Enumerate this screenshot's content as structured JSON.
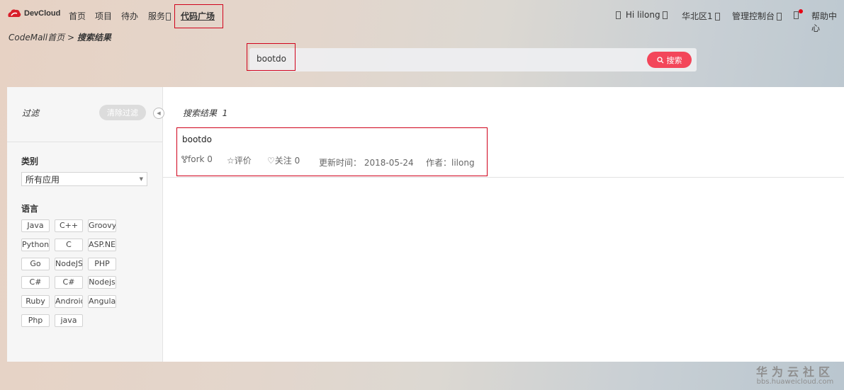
{
  "nav": {
    "brand": "DevCloud",
    "items": [
      "首页",
      "项目",
      "待办",
      "服务"
    ],
    "active": "代码广场",
    "greeting": "Hi lilong",
    "region": "华北区1",
    "console": "管理控制台",
    "help": "帮助中心"
  },
  "breadcrumb": {
    "home": "CodeMall首页",
    "separator": ">",
    "current": "搜索结果"
  },
  "search": {
    "value": "bootdo",
    "button": "搜索"
  },
  "sidebar": {
    "filter_title": "过滤",
    "clear_button": "清除过滤",
    "category_label": "类别",
    "category_value": "所有应用",
    "language_label": "语言",
    "languages": [
      "Java",
      "C++",
      "Groovy",
      "Python",
      "C",
      "ASP.NET",
      "Go",
      "NodeJS",
      "PHP",
      "C#",
      "C#",
      "Nodejs",
      "Ruby",
      "Android",
      "Angularjs",
      "Php",
      "java"
    ]
  },
  "results": {
    "title": "搜索结果",
    "count": "1",
    "items": [
      {
        "name": "bootdo",
        "fork_label": "fork",
        "fork": "0",
        "rating_label": "评价",
        "follow_label": "关注",
        "follow": "0",
        "updated_label": "更新时间：",
        "updated": "2018-05-24",
        "author_label": "作者：",
        "author": "lilong"
      }
    ]
  },
  "watermark": {
    "line1": "华为云社区",
    "line2": "bbs.huaweicloud.com"
  },
  "colors": {
    "accent": "#f3465a",
    "highlight_border": "#d0021b",
    "notification_dot": "#e60012"
  }
}
